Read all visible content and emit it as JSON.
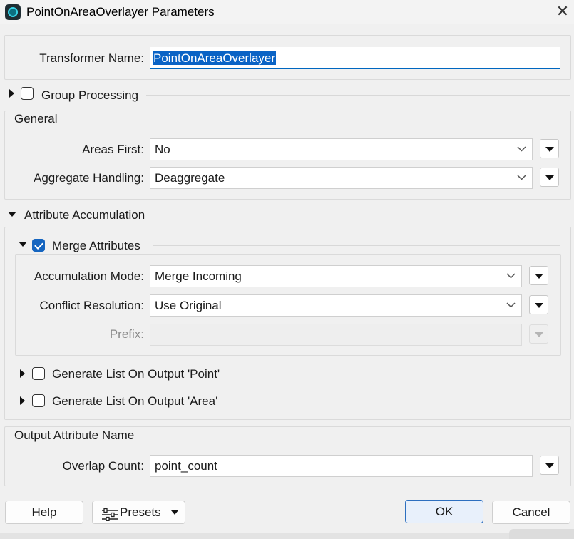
{
  "window": {
    "title": "PointOnAreaOverlayer Parameters",
    "close_label": "✕"
  },
  "transformer_name": {
    "label": "Transformer Name:",
    "value": "PointOnAreaOverlayer"
  },
  "group_processing": {
    "label": "Group Processing",
    "checked": false
  },
  "general": {
    "title": "General",
    "areas_first": {
      "label": "Areas First:",
      "value": "No"
    },
    "aggregate_handling": {
      "label": "Aggregate Handling:",
      "value": "Deaggregate"
    }
  },
  "attribute_accumulation": {
    "title": "Attribute Accumulation",
    "merge_attributes": {
      "label": "Merge Attributes",
      "checked": true
    },
    "accumulation_mode": {
      "label": "Accumulation Mode:",
      "value": "Merge Incoming"
    },
    "conflict_resolution": {
      "label": "Conflict Resolution:",
      "value": "Use Original"
    },
    "prefix": {
      "label": "Prefix:",
      "value": ""
    },
    "list_point": {
      "label": "Generate List On Output 'Point'",
      "checked": false
    },
    "list_area": {
      "label": "Generate List On Output 'Area'",
      "checked": false
    }
  },
  "output_attribute_name": {
    "title": "Output Attribute Name",
    "overlap_count": {
      "label": "Overlap Count:",
      "value": "point_count"
    }
  },
  "footer": {
    "help": "Help",
    "presets": "Presets",
    "ok": "OK",
    "cancel": "Cancel"
  },
  "colors": {
    "accent": "#0067c0",
    "checkbox_checked": "#1565c0",
    "app_icon": "#38d3e6"
  }
}
